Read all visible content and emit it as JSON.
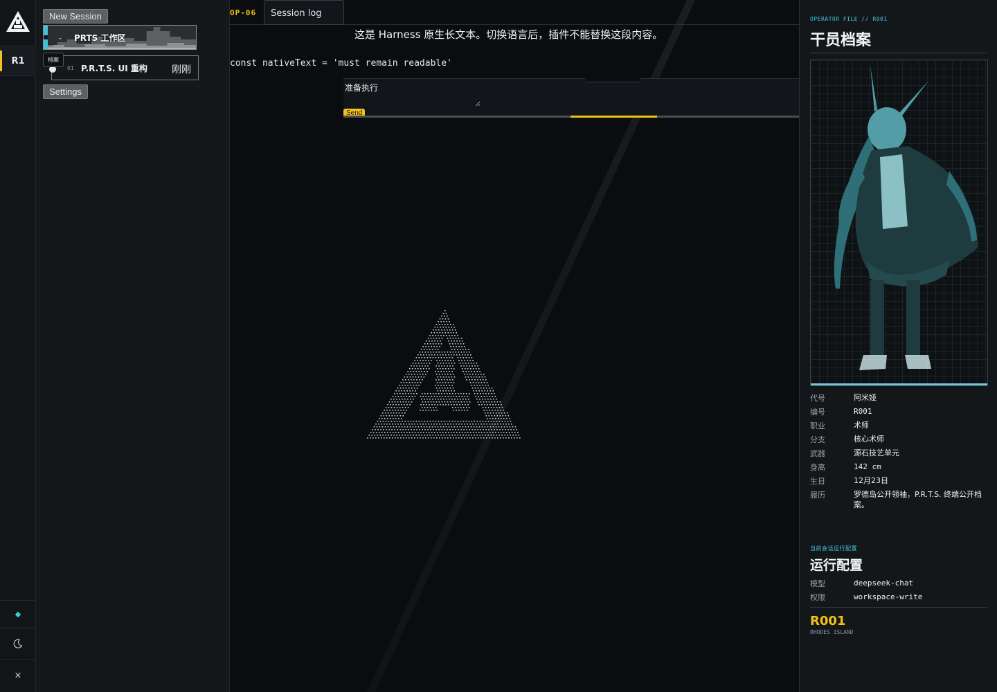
{
  "rail": {
    "active_label": "R1",
    "theme_toggle_icon": "moon-icon",
    "status_icon": "diamond-icon",
    "close_label": "×"
  },
  "sessions": {
    "new_label": "New Session",
    "workspace_label": "PRTS 工作区",
    "item_tag": "档案",
    "item_number": "01",
    "item_title": "P.R.T.S. UI 重构",
    "item_time": "刚刚",
    "settings_label": "Settings"
  },
  "main": {
    "op_code": "OP-06",
    "tab_label": "Session log",
    "native_text": "这是 Harness 原生长文本。切换语言后，插件不能替换这段内容。",
    "code_line": "const nativeText = 'must remain readable'",
    "composer_value": "准备执行",
    "send_label": "Send",
    "progress": 0.19
  },
  "dossier": {
    "eyebrow": "OPERATOR FILE // R001",
    "title": "干员档案",
    "fields": [
      {
        "k": "代号",
        "v": "阿米娅"
      },
      {
        "k": "编号",
        "v": "R001"
      },
      {
        "k": "职业",
        "v": "术师"
      },
      {
        "k": "分支",
        "v": "核心术师"
      },
      {
        "k": "武器",
        "v": "源石技艺单元"
      },
      {
        "k": "身高",
        "v": "142 cm"
      },
      {
        "k": "生日",
        "v": "12月23日"
      },
      {
        "k": "履历",
        "v": "罗德岛公开领袖，P.R.T.S. 终端公开档案。"
      }
    ],
    "run_eyebrow": "当前会话运行配置",
    "run_title": "运行配置",
    "run_fields": [
      {
        "k": "模型",
        "v": "deepseek-chat"
      },
      {
        "k": "权限",
        "v": "workspace-write"
      }
    ],
    "badge_code": "R001",
    "badge_sub": "RHODES ISLAND"
  },
  "colors": {
    "accent": "#f4c21b",
    "cyan": "#3ec9de",
    "bg": "#0b0d10"
  }
}
